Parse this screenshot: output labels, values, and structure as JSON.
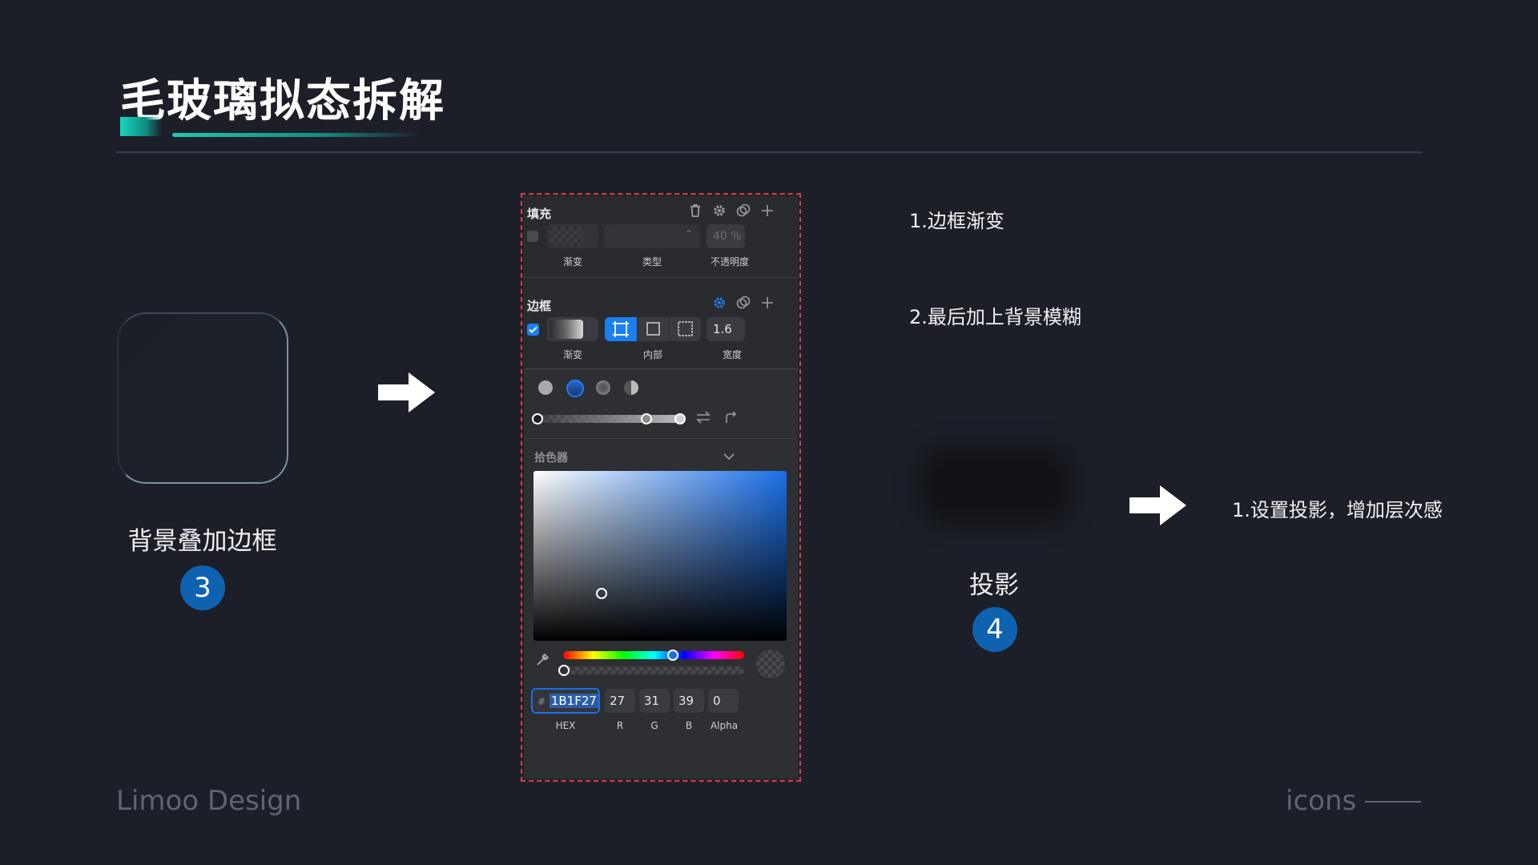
{
  "title": "毛玻璃拟态拆解",
  "left_caption": "背景叠加边框",
  "badge_left": "3",
  "right_notes": {
    "note1": "1.边框渐变",
    "note2": "2.最后加上背景模糊",
    "note3": "1.设置投影，增加层次感"
  },
  "shadow_caption": "投影",
  "badge_right": "4",
  "footer": {
    "brand": "Limoo Design",
    "section": "icons"
  },
  "panel": {
    "fill": {
      "header": "填充",
      "type_label": "渐变",
      "kind_label": "类型",
      "opacity_label": "不透明度",
      "opacity_value": "40",
      "opacity_unit": "%"
    },
    "border": {
      "header": "边框",
      "type_label": "渐变",
      "position_label": "内部",
      "width_label": "宽度",
      "width_value": "1.6"
    },
    "picker": {
      "label": "拾色器",
      "hex_prefix": "#",
      "hex_value": "1B1F27",
      "r": "27",
      "g": "31",
      "b": "39",
      "alpha": "0",
      "hex_label": "HEX",
      "r_label": "R",
      "g_label": "G",
      "b_label": "B",
      "alpha_label": "Alpha"
    }
  },
  "colors": {
    "accent_teal": "#1cc9b4",
    "badge_blue": "#0f62b0",
    "panel_blue": "#1a7ff0",
    "dashed_frame": "#e43b44"
  }
}
